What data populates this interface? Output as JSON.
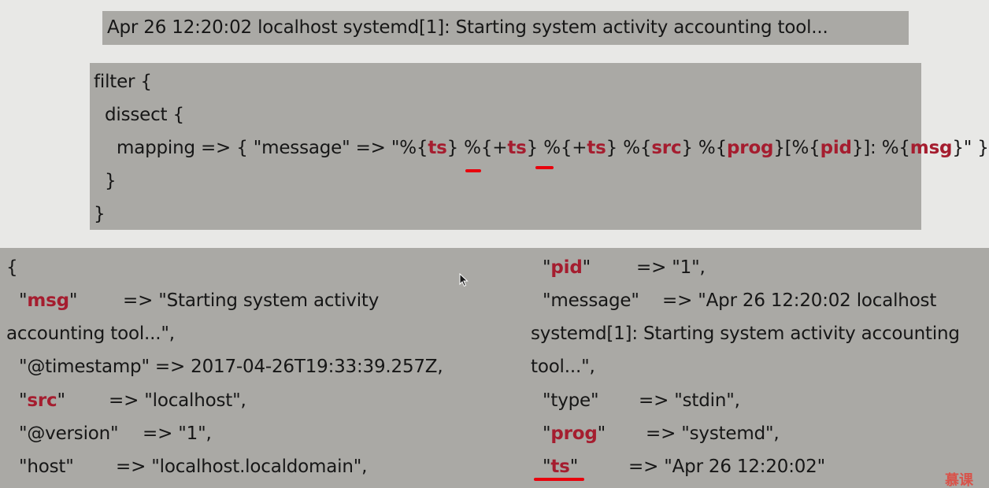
{
  "log_line": "Apr 26 12:20:02 localhost systemd[1]: Starting system activity accounting tool...",
  "filter": {
    "open": "filter {",
    "dissect_open": "dissect {",
    "m_prefix": "mapping => { \"message\" => \"%{",
    "m_ts1": "ts",
    "m_sep1": "} %{+",
    "m_ts2": "ts",
    "m_sep2": "} %{+",
    "m_ts3": "ts",
    "m_sep3": "} %{",
    "m_src": "src",
    "m_sep4": "} %{",
    "m_prog": "prog",
    "m_sep5": "}[%{",
    "m_pid": "pid",
    "m_sep6": "}]: %{",
    "m_msg": "msg",
    "m_suffix": "}\" }",
    "dissect_close": "}",
    "close": "}"
  },
  "output": {
    "open_brace": "{",
    "msg_q1": "\"",
    "msg_key": "msg",
    "msg_q2": "\"",
    "msg_val": "=> \"Starting system activity",
    "msg_val_cont": "accounting tool...\",",
    "timestamp_line": "\"@timestamp\" => 2017-04-26T19:33:39.257Z,",
    "src_q1": "\"",
    "src_key": "src",
    "src_q2": "\"",
    "src_val": "=> \"localhost\",",
    "version_key": "\"@version\"",
    "version_val": "=> \"1\",",
    "host_key": "\"host\"",
    "host_val": "=> \"localhost.localdomain\",",
    "pid_q1": "\"",
    "pid_key": "pid",
    "pid_q2": "\"",
    "pid_val": "=> \"1\",",
    "message_key": "\"message\"",
    "message_val": "=> \"Apr 26 12:20:02 localhost",
    "message_val_cont1": "systemd[1]: Starting system activity accounting",
    "message_val_cont2": "tool...\",",
    "type_key": "\"type\"",
    "type_val": "=> \"stdin\",",
    "prog_q1": "\"",
    "prog_key": "prog",
    "prog_q2": "\"",
    "prog_val": "=> \"systemd\",",
    "ts_q1": "\"",
    "ts_key": "ts",
    "ts_q2": "\"",
    "ts_val": "=> \"Apr 26 12:20:02\""
  },
  "watermark": "慕课",
  "colors": {
    "key": "#a51d2f",
    "underline": "#e8000c",
    "panel": "#aaa9a5",
    "background": "#e8e8e6"
  },
  "icons": {
    "pointer": "mouse-pointer-icon"
  }
}
